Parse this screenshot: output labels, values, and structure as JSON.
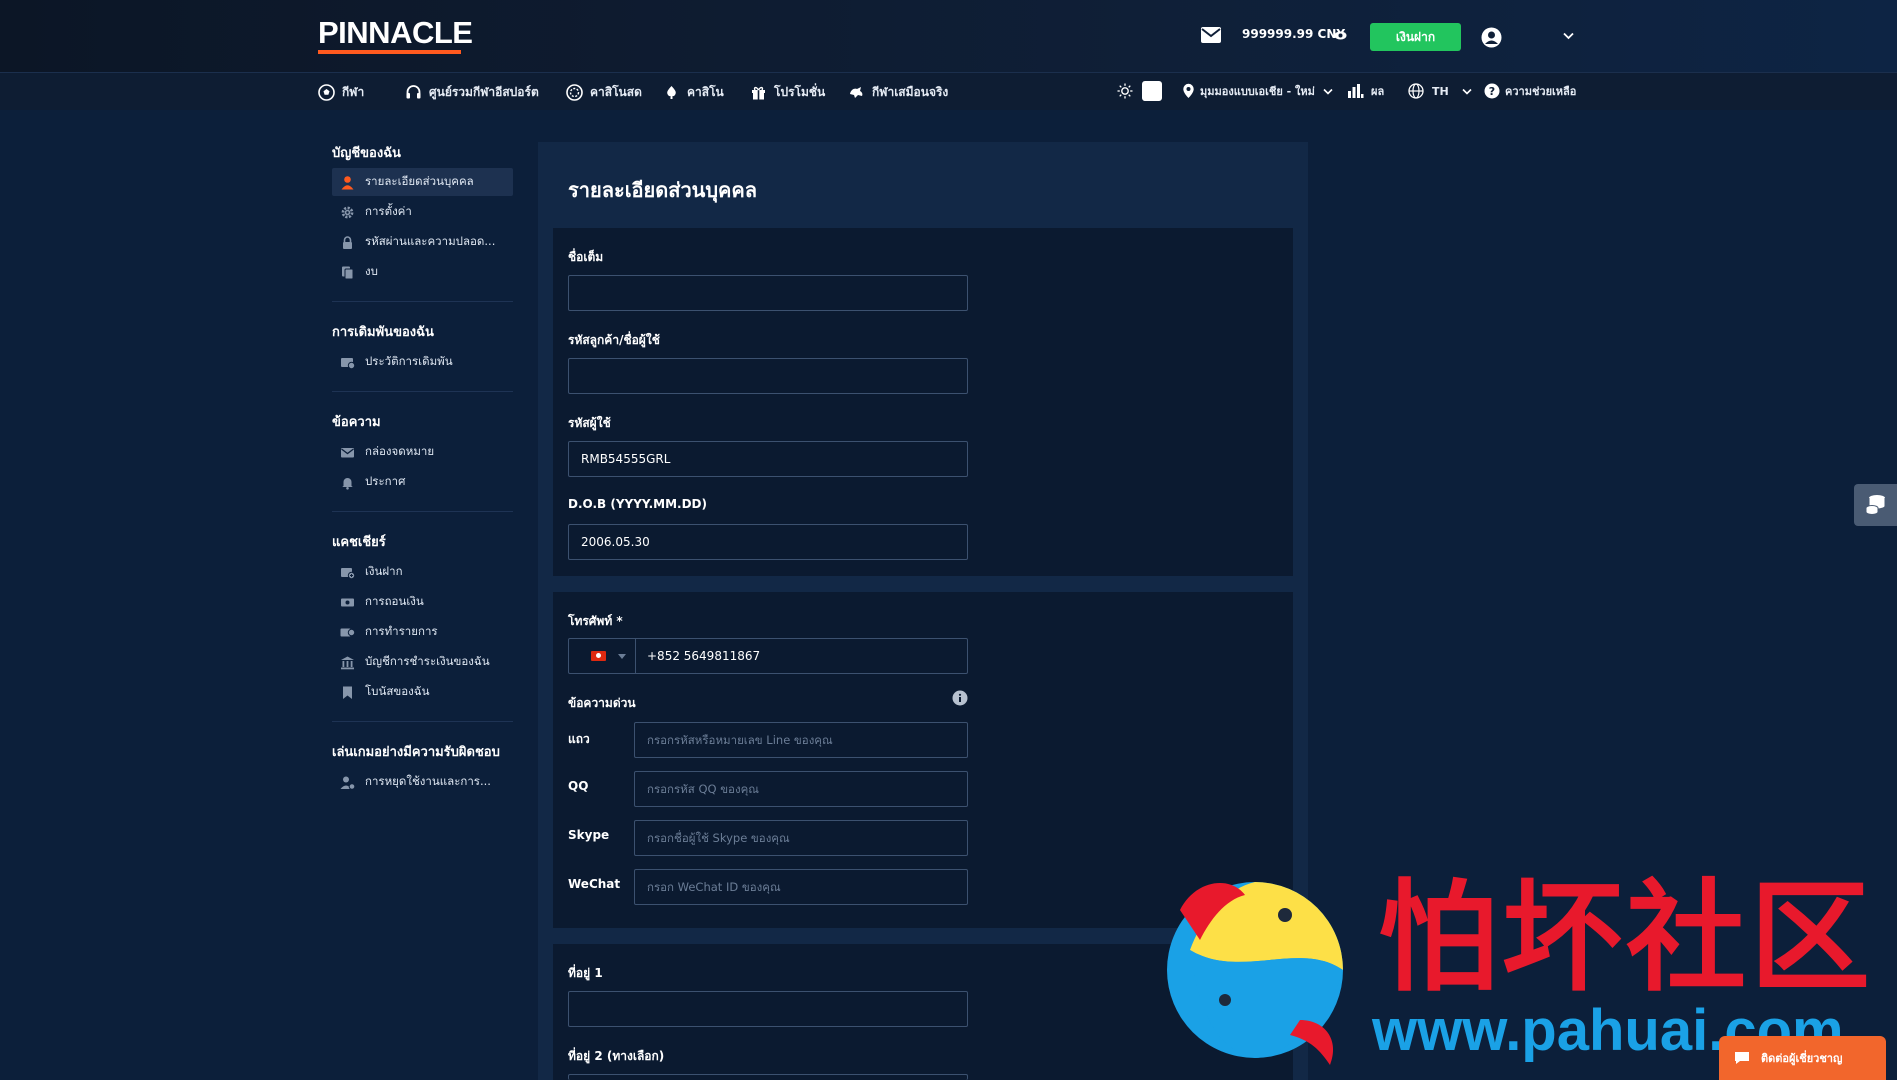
{
  "header": {
    "logo": "PINNACLE",
    "balance": "999999.99  CNY",
    "deposit_label": "เงินฝาก"
  },
  "nav": {
    "items": [
      {
        "label": "กีฬา",
        "icon": "soccer-ball-icon"
      },
      {
        "label": "ศูนย์รวมกีฬาอีสปอร์ต",
        "icon": "headset-icon"
      },
      {
        "label": "คาสิโนสด",
        "icon": "chip-icon"
      },
      {
        "label": "คาสิโน",
        "icon": "cards-icon"
      },
      {
        "label": "โปรโมชั่น",
        "icon": "gift-icon"
      },
      {
        "label": "กีฬาเสมือนจริง",
        "icon": "virtual-sports-icon"
      }
    ],
    "region": "มุมมองแบบเอเชีย - ใหม่",
    "results": "ผล",
    "language": "TH",
    "help": "ความช่วยเหลือ"
  },
  "sidebar": {
    "sections": [
      {
        "title": "บัญชีของฉัน",
        "items": [
          {
            "label": "รายละเอียดส่วนบุคคล",
            "active": true,
            "icon": "user-icon"
          },
          {
            "label": "การตั้งค่า",
            "active": false,
            "icon": "gear-icon"
          },
          {
            "label": "รหัสผ่านและความปลอด...",
            "active": false,
            "icon": "lock-icon"
          },
          {
            "label": "งบ",
            "active": false,
            "icon": "documents-icon"
          }
        ]
      },
      {
        "title": "การเดิมพันของฉัน",
        "items": [
          {
            "label": "ประวัติการเดิมพัน",
            "active": false,
            "icon": "bet-history-icon"
          }
        ]
      },
      {
        "title": "ข้อความ",
        "items": [
          {
            "label": "กล่องจดหมาย",
            "active": false,
            "icon": "mail-icon"
          },
          {
            "label": "ประกาศ",
            "active": false,
            "icon": "bell-icon"
          }
        ]
      },
      {
        "title": "แคชเชียร์",
        "items": [
          {
            "label": "เงินฝาก",
            "active": false,
            "icon": "deposit-icon"
          },
          {
            "label": "การถอนเงิน",
            "active": false,
            "icon": "withdraw-icon"
          },
          {
            "label": "การทำรายการ",
            "active": false,
            "icon": "transactions-icon"
          },
          {
            "label": "บัญชีการชำระเงินของฉัน",
            "active": false,
            "icon": "bank-icon"
          },
          {
            "label": "โบนัสของฉัน",
            "active": false,
            "icon": "bookmark-icon"
          }
        ]
      },
      {
        "title": "เล่นเกมอย่างมีความรับผิดชอบ",
        "items": [
          {
            "label": "การหยุดใช้งานและการ...",
            "active": false,
            "icon": "user-pause-icon"
          }
        ]
      }
    ]
  },
  "personal": {
    "title": "รายละเอียดส่วนบุคคล",
    "full_name": {
      "label": "ชื่อเต็ม",
      "value": ""
    },
    "customer_id": {
      "label": "รหัสลูกค้า/ชื่อผู้ใช้",
      "value": ""
    },
    "user_id": {
      "label": "รหัสผู้ใช้",
      "value": "RMB54555GRL"
    },
    "dob": {
      "label": "D.O.B (YYYY.MM.DD)",
      "value": "2006.05.30"
    },
    "phone": {
      "label": "โทรศัพท์ *",
      "value": "+852 5649811867"
    },
    "instant_messaging": {
      "title": "ข้อความด่วน",
      "line": {
        "label": "แถว",
        "placeholder": "กรอกรหัสหรือหมายเลข Line ของคุณ"
      },
      "qq": {
        "label": "QQ",
        "placeholder": "กรอกรหัส QQ ของคุณ"
      },
      "skype": {
        "label": "Skype",
        "placeholder": "กรอกชื่อผู้ใช้ Skype ของคุณ"
      },
      "wechat": {
        "label": "WeChat",
        "placeholder": "กรอก WeChat ID ของคุณ"
      }
    },
    "address1": {
      "label": "ที่อยู่ 1",
      "value": ""
    },
    "address2": {
      "label": "ที่อยู่ 2 (ทางเลือก)"
    }
  },
  "watermark": {
    "title": "怕坏社区",
    "url": "www.pahuai.com"
  },
  "chat": {
    "label": "ติดต่อผู้เชี่ยวชาญ"
  },
  "colors": {
    "deposit": "#22c55e",
    "brand_underline": "#ff5a1f",
    "chat": "#f2662c",
    "watermark_red": "#e8192c",
    "watermark_blue": "#1aa1e6"
  }
}
